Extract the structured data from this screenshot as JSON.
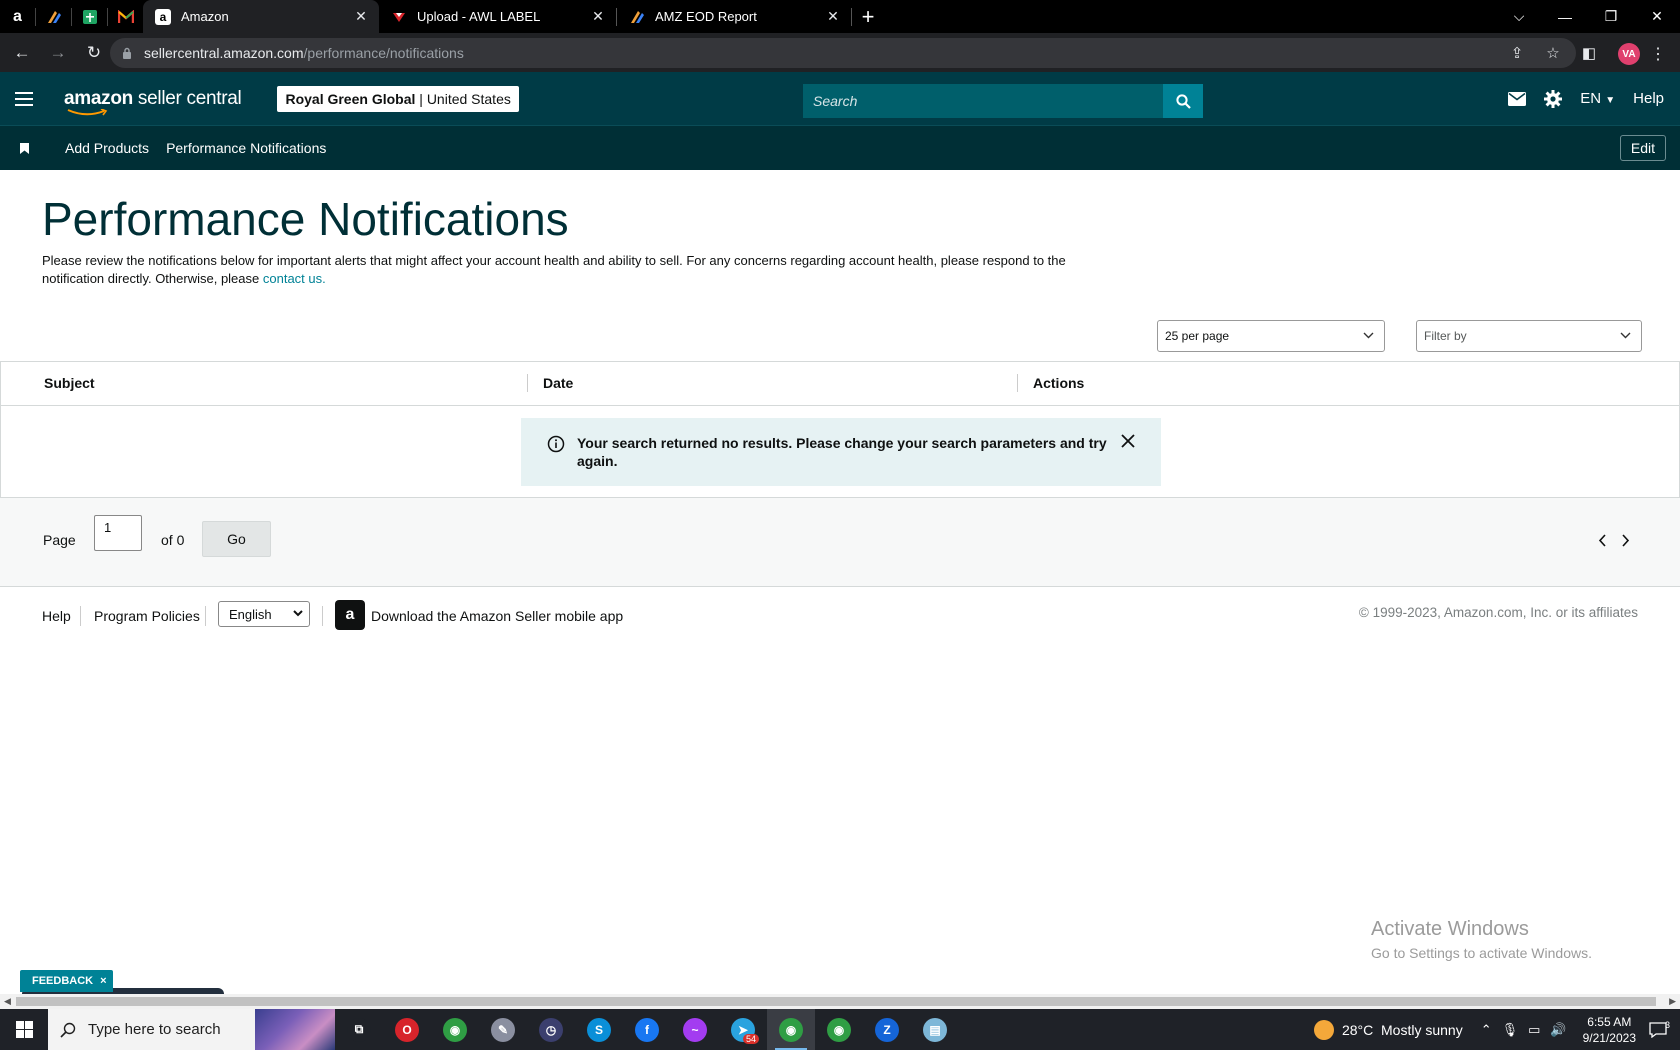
{
  "browser": {
    "pinned_tabs": [
      {
        "icon": "amazon-icon",
        "glyph": "a"
      },
      {
        "icon": "zoho-icon",
        "glyph": ""
      },
      {
        "icon": "sheets-icon",
        "glyph": ""
      },
      {
        "icon": "gmail-icon",
        "glyph": "M"
      }
    ],
    "tabs": [
      {
        "label": "Amazon",
        "icon": "amazon-icon",
        "active": true
      },
      {
        "label": "Upload - AWL LABEL",
        "icon": "awl-icon",
        "active": false
      },
      {
        "label": "AMZ EOD Report",
        "icon": "zoho-icon",
        "active": false
      }
    ],
    "url_host": "sellercentral.amazon.com",
    "url_path": "/performance/notifications",
    "profile_initials": "VA"
  },
  "header": {
    "logo_bold": "amazon",
    "logo_rest": " seller central",
    "store_name": "Royal Green Global",
    "store_sep": " | ",
    "store_region": "United States",
    "search_placeholder": "Search",
    "language": "EN",
    "help": "Help"
  },
  "nav": {
    "items": [
      "Add Products",
      "Performance Notifications"
    ],
    "edit": "Edit"
  },
  "page": {
    "title": "Performance Notifications",
    "description": "Please review the notifications below for important alerts that might affect your account health and ability to sell. For any concerns regarding account health, please respond to the notification directly. Otherwise, please ",
    "contact_link": "contact us."
  },
  "controls": {
    "per_page": "25 per page",
    "filter_placeholder": "Filter by"
  },
  "table": {
    "columns": [
      "Subject",
      "Date",
      "Actions"
    ],
    "rows": [],
    "empty_message": "Your search returned no results. Please change your search parameters and try again."
  },
  "pagination": {
    "page_label": "Page",
    "current_page": "1",
    "of_label": "of 0",
    "go": "Go"
  },
  "footer": {
    "help": "Help",
    "program_policies": "Program Policies",
    "language": "English",
    "app_link": "Download the Amazon Seller mobile app",
    "copyright": "© 1999-2023, Amazon.com, Inc. or its affiliates"
  },
  "windows_watermark": {
    "line1": "Activate Windows",
    "line2": "Go to Settings to activate Windows."
  },
  "feedback": {
    "label": "FEEDBACK",
    "close": "×"
  },
  "taskbar": {
    "search_placeholder": "Type here to search",
    "apps": [
      {
        "name": "task-view-icon",
        "color": "#1f2228",
        "glyph": "⧉"
      },
      {
        "name": "opera-icon",
        "color": "#d7242b",
        "glyph": "O"
      },
      {
        "name": "chrome-icon",
        "color": "#2f9e44",
        "glyph": "◉"
      },
      {
        "name": "paint-icon",
        "color": "#8a8fa0",
        "glyph": "✎"
      },
      {
        "name": "clock-app-icon",
        "color": "#3b3f6e",
        "glyph": "◷"
      },
      {
        "name": "skype-icon",
        "color": "#0a8fd8",
        "glyph": "S"
      },
      {
        "name": "facebook-icon",
        "color": "#1877f2",
        "glyph": "f"
      },
      {
        "name": "messenger-icon",
        "color": "#a33cf0",
        "glyph": "~"
      },
      {
        "name": "telegram-icon",
        "color": "#2aa3df",
        "glyph": "➤",
        "badge": "54"
      },
      {
        "name": "chrome-profile-va-icon",
        "color": "#2f9e44",
        "glyph": "◉",
        "active": true
      },
      {
        "name": "chrome-profile-w-icon",
        "color": "#2f9e44",
        "glyph": "◉"
      },
      {
        "name": "zoho-z-icon",
        "color": "#1565d8",
        "glyph": "Z"
      },
      {
        "name": "notes-icon",
        "color": "#7db7d8",
        "glyph": "▤"
      }
    ],
    "weather": "28°C  Mostly sunny",
    "time": "6:55 AM",
    "date": "9/21/2023",
    "notifications_count": "3"
  }
}
